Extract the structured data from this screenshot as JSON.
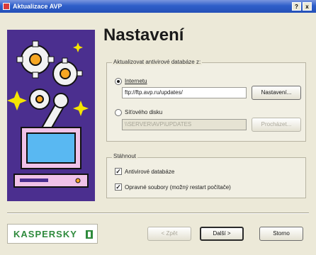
{
  "window": {
    "title": "Aktualizace AVP",
    "help_button": "?",
    "close_button": "x"
  },
  "main": {
    "title": "Nastavení"
  },
  "source_group": {
    "label": "Aktualizovat antivirové databáze z:",
    "internet": {
      "label": "Internetu",
      "url": "ftp://ftp.avp.ru/updates/",
      "settings_button": "Nastavení..."
    },
    "network": {
      "label": "Síťového disku",
      "path": "\\\\SERVER\\AVP\\UPDATES",
      "browse_button": "Procházet..."
    }
  },
  "download_group": {
    "label": "Stáhnout",
    "items": [
      {
        "label": "Antivirové databáze",
        "checked": true
      },
      {
        "label": "Opravné soubory (možný restart počítače)",
        "checked": true
      }
    ]
  },
  "footer": {
    "logo": "KASPERSKY",
    "back_button": "< Zpět",
    "next_button": "Další >",
    "cancel_button": "Storno"
  }
}
